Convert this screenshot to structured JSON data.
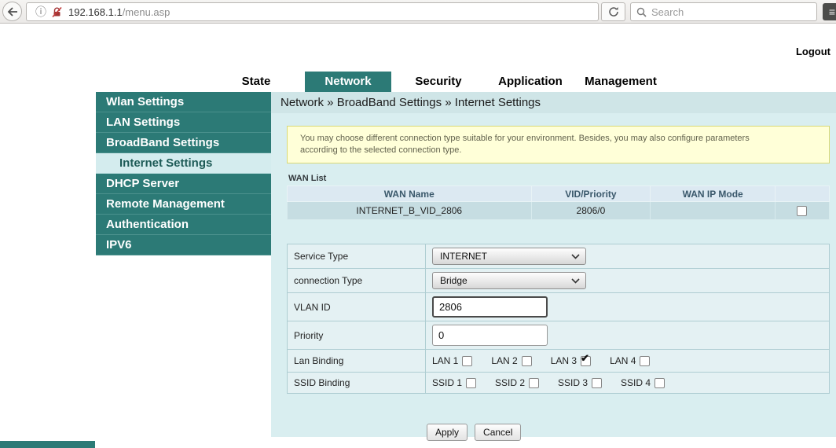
{
  "colors": {
    "accent_teal": "#2c7a76",
    "content_bg": "#d9eef0",
    "notice_bg": "#ffffd8",
    "table_header_bg": "#dce9f2",
    "table_row_bg": "#c6dde2"
  },
  "browser": {
    "url_host": "192.168.1.1",
    "url_path": "/menu.asp",
    "search_placeholder": "Search"
  },
  "header": {
    "logout_label": "Logout",
    "tabs": [
      {
        "label": "State",
        "active": false
      },
      {
        "label": "Network",
        "active": true
      },
      {
        "label": "Security",
        "active": false
      },
      {
        "label": "Application",
        "active": false
      },
      {
        "label": "Management",
        "active": false
      }
    ]
  },
  "sidebar": {
    "items": [
      {
        "label": "Wlan Settings",
        "active": false
      },
      {
        "label": "LAN Settings",
        "active": false
      },
      {
        "label": "BroadBand Settings",
        "active": false
      },
      {
        "label": "Internet Settings",
        "active": true
      },
      {
        "label": "DHCP Server",
        "active": false
      },
      {
        "label": "Remote Management",
        "active": false
      },
      {
        "label": "Authentication",
        "active": false
      },
      {
        "label": "IPV6",
        "active": false
      }
    ]
  },
  "breadcrumb": "Network » BroadBand Settings » Internet Settings",
  "notice": {
    "line1": "You may choose different connection type suitable for your environment. Besides, you may also configure parameters",
    "line2": "according to the selected connection type."
  },
  "wan_list": {
    "title": "WAN List",
    "headers": [
      "WAN Name",
      "VID/Priority",
      "WAN IP Mode",
      ""
    ],
    "rows": [
      {
        "name": "INTERNET_B_VID_2806",
        "vid_priority": "2806/0",
        "wan_ip_mode": "",
        "selected": false
      }
    ]
  },
  "form": {
    "service_type": {
      "label": "Service Type",
      "value": "INTERNET"
    },
    "connection_type": {
      "label": "connection Type",
      "value": "Bridge"
    },
    "vlan_id": {
      "label": "VLAN ID",
      "value": "2806"
    },
    "priority": {
      "label": "Priority",
      "value": "0"
    },
    "lan_binding": {
      "label": "Lan Binding",
      "options": [
        {
          "label": "LAN 1",
          "checked": false
        },
        {
          "label": "LAN 2",
          "checked": false
        },
        {
          "label": "LAN 3",
          "checked": true
        },
        {
          "label": "LAN 4",
          "checked": false
        }
      ]
    },
    "ssid_binding": {
      "label": "SSID Binding",
      "options": [
        {
          "label": "SSID 1",
          "checked": false
        },
        {
          "label": "SSID 2",
          "checked": false
        },
        {
          "label": "SSID 3",
          "checked": false
        },
        {
          "label": "SSID 4",
          "checked": false
        }
      ]
    }
  },
  "buttons": {
    "apply": "Apply",
    "cancel": "Cancel"
  }
}
